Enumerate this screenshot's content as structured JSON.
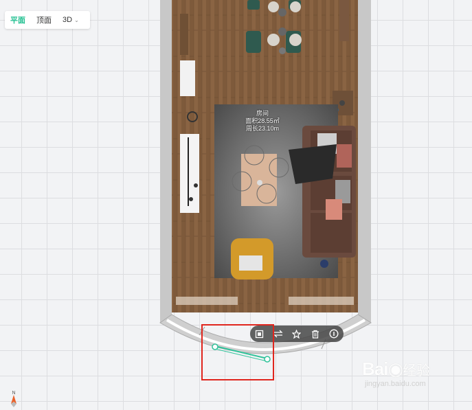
{
  "view_tabs": [
    "平面",
    "顶面",
    "3D"
  ],
  "active_tab": "平面",
  "room": {
    "name": "房间",
    "area": "面积28.55㎡",
    "perimeter": "周长23.10m"
  },
  "action_bar": {
    "icons": [
      "copy-icon",
      "flip-icon",
      "favorite-icon",
      "delete-icon",
      "info-icon"
    ]
  },
  "compass": {
    "label": "N"
  },
  "watermark": {
    "logo": "Bai",
    "brand_tail": "经验",
    "url": "jingyan.baidu.com"
  },
  "colors": {
    "accent": "#1fbf8f",
    "highlight": "#e0251d",
    "wall": "#c4c4c4",
    "floor": "#8a6443"
  }
}
